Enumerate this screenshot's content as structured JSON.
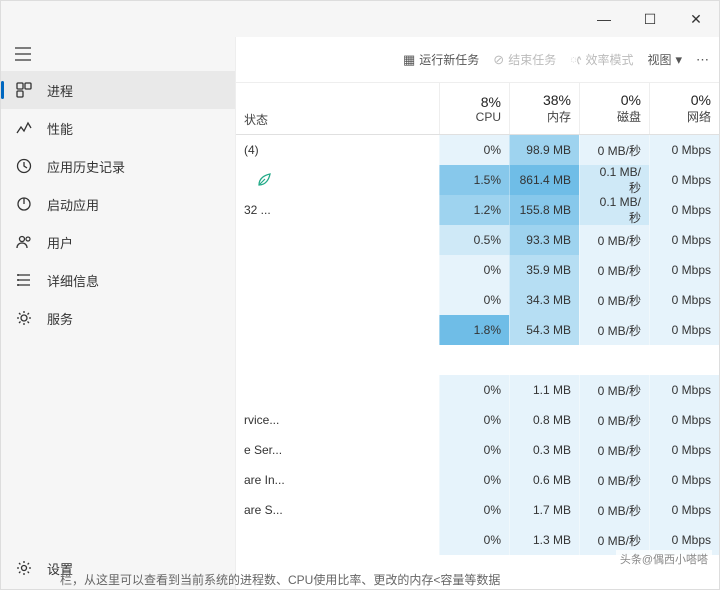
{
  "window_controls": {
    "min": "—",
    "max": "☐",
    "close": "✕"
  },
  "sidebar": {
    "items": [
      {
        "label": "进程"
      },
      {
        "label": "性能"
      },
      {
        "label": "应用历史记录"
      },
      {
        "label": "启动应用"
      },
      {
        "label": "用户"
      },
      {
        "label": "详细信息"
      },
      {
        "label": "服务"
      }
    ],
    "settings_label": "设置"
  },
  "toolbar": {
    "run_task": "运行新任务",
    "end_task": "结束任务",
    "efficiency": "效率模式",
    "view": "视图"
  },
  "columns": {
    "status": "状态",
    "cpu": {
      "pct": "8%",
      "label": "CPU"
    },
    "mem": {
      "pct": "38%",
      "label": "内存"
    },
    "disk": {
      "pct": "0%",
      "label": "磁盘"
    },
    "net": {
      "pct": "0%",
      "label": "网络"
    }
  },
  "groups": [
    {
      "rows": [
        {
          "name": "(4)",
          "status": "",
          "cpu": "0%",
          "mem": "98.9 MB",
          "disk": "0 MB/秒",
          "net": "0 Mbps",
          "lv": [
            1,
            4,
            1,
            1
          ]
        },
        {
          "name": "",
          "status": "leaf",
          "cpu": "1.5%",
          "mem": "861.4 MB",
          "disk": "0.1 MB/秒",
          "net": "0 Mbps",
          "lv": [
            5,
            6,
            2,
            1
          ]
        },
        {
          "name": "32 ...",
          "status": "",
          "cpu": "1.2%",
          "mem": "155.8 MB",
          "disk": "0.1 MB/秒",
          "net": "0 Mbps",
          "lv": [
            4,
            5,
            2,
            1
          ]
        },
        {
          "name": "",
          "status": "",
          "cpu": "0.5%",
          "mem": "93.3 MB",
          "disk": "0 MB/秒",
          "net": "0 Mbps",
          "lv": [
            2,
            4,
            1,
            1
          ]
        },
        {
          "name": "",
          "status": "",
          "cpu": "0%",
          "mem": "35.9 MB",
          "disk": "0 MB/秒",
          "net": "0 Mbps",
          "lv": [
            1,
            3,
            1,
            1
          ]
        },
        {
          "name": "",
          "status": "",
          "cpu": "0%",
          "mem": "34.3 MB",
          "disk": "0 MB/秒",
          "net": "0 Mbps",
          "lv": [
            1,
            3,
            1,
            1
          ]
        },
        {
          "name": "",
          "status": "",
          "cpu": "1.8%",
          "mem": "54.3 MB",
          "disk": "0 MB/秒",
          "net": "0 Mbps",
          "lv": [
            6,
            3,
            1,
            1
          ]
        }
      ]
    },
    {
      "rows": [
        {
          "name": "",
          "status": "",
          "cpu": "0%",
          "mem": "1.1 MB",
          "disk": "0 MB/秒",
          "net": "0 Mbps",
          "lv": [
            1,
            1,
            1,
            1
          ]
        },
        {
          "name": "rvice...",
          "status": "",
          "cpu": "0%",
          "mem": "0.8 MB",
          "disk": "0 MB/秒",
          "net": "0 Mbps",
          "lv": [
            1,
            1,
            1,
            1
          ]
        },
        {
          "name": "e Ser...",
          "status": "",
          "cpu": "0%",
          "mem": "0.3 MB",
          "disk": "0 MB/秒",
          "net": "0 Mbps",
          "lv": [
            1,
            1,
            1,
            1
          ]
        },
        {
          "name": "are In...",
          "status": "",
          "cpu": "0%",
          "mem": "0.6 MB",
          "disk": "0 MB/秒",
          "net": "0 Mbps",
          "lv": [
            1,
            1,
            1,
            1
          ]
        },
        {
          "name": "are S...",
          "status": "",
          "cpu": "0%",
          "mem": "1.7 MB",
          "disk": "0 MB/秒",
          "net": "0 Mbps",
          "lv": [
            1,
            1,
            1,
            1
          ]
        },
        {
          "name": "",
          "status": "",
          "cpu": "0%",
          "mem": "1.3 MB",
          "disk": "0 MB/秒",
          "net": "0 Mbps",
          "lv": [
            1,
            1,
            1,
            1
          ]
        }
      ]
    }
  ],
  "watermark": "头条@偶西小嗒嗒",
  "footer": "栏，从这里可以查看到当前系统的进程数、CPU使用比率、更改的内存<容量等数据"
}
